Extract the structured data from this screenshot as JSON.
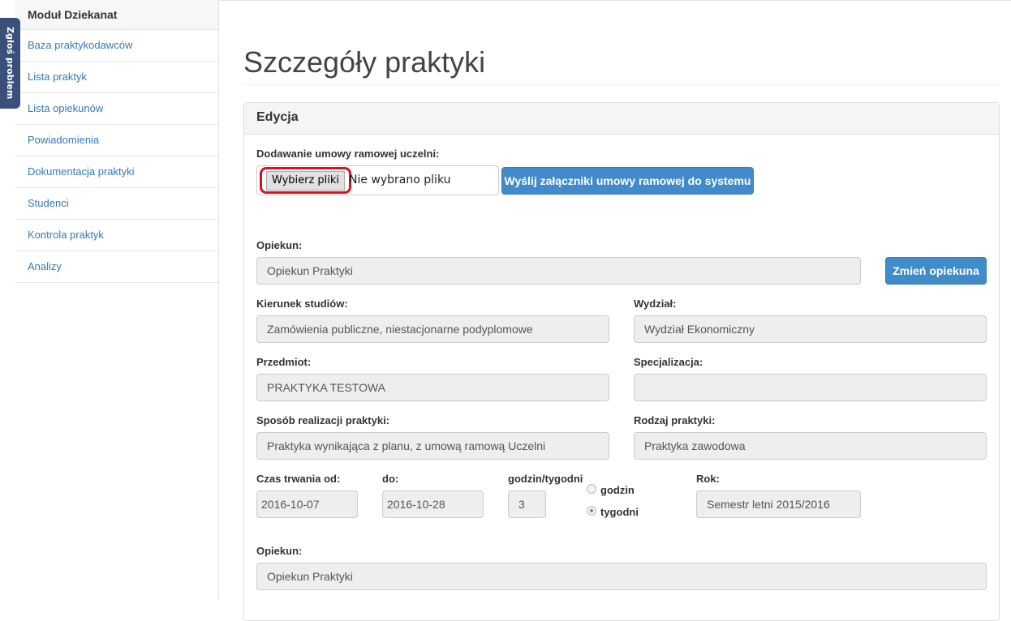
{
  "feedback": {
    "label": "Zgłoś problem"
  },
  "sidebar": {
    "header": "Moduł Dziekanat",
    "items": [
      {
        "label": "Baza praktykodawców"
      },
      {
        "label": "Lista praktyk"
      },
      {
        "label": "Lista opiekunów"
      },
      {
        "label": "Powiadomienia"
      },
      {
        "label": "Dokumentacja praktyki"
      },
      {
        "label": "Studenci"
      },
      {
        "label": "Kontrola praktyk"
      },
      {
        "label": "Analizy"
      }
    ]
  },
  "page": {
    "title": "Szczegóły praktyki"
  },
  "panel": {
    "heading": "Edycja",
    "upload": {
      "label": "Dodawanie umowy ramowej uczelni:",
      "choose_button": "Wybierz pliki",
      "status": "Nie wybrano pliku",
      "send_button": "Wyślij załączniki umowy ramowej do systemu"
    },
    "supervisor": {
      "label": "Opiekun:",
      "value": "Opiekun Praktyki",
      "change_button": "Zmień opiekuna"
    },
    "field_of_study": {
      "label": "Kierunek studiów:",
      "value": "Zamówienia publiczne, niestacjonarne podyplomowe"
    },
    "faculty": {
      "label": "Wydział:",
      "value": "Wydział Ekonomiczny"
    },
    "subject": {
      "label": "Przedmiot:",
      "value": "PRAKTYKA TESTOWA"
    },
    "specialization": {
      "label": "Specjalizacja:",
      "value": ""
    },
    "mode": {
      "label": "Sposób realizacji praktyki:",
      "value": "Praktyka wynikająca z planu, z umową ramową Uczelni"
    },
    "type": {
      "label": "Rodzaj praktyki:",
      "value": "Praktyka zawodowa"
    },
    "duration_from": {
      "label": "Czas trwania od:",
      "value": "2016-10-07"
    },
    "duration_to": {
      "label": "do:",
      "value": "2016-10-28"
    },
    "hours": {
      "label": "godzin/tygodni",
      "value": "3"
    },
    "hours_unit": {
      "option_hours": "godzin",
      "option_weeks": "tygodni",
      "selected": "tygodni"
    },
    "year": {
      "label": "Rok:",
      "value": "Semestr letni 2015/2016"
    },
    "supervisor2": {
      "label": "Opiekun:",
      "value": "Opiekun Praktyki"
    }
  }
}
